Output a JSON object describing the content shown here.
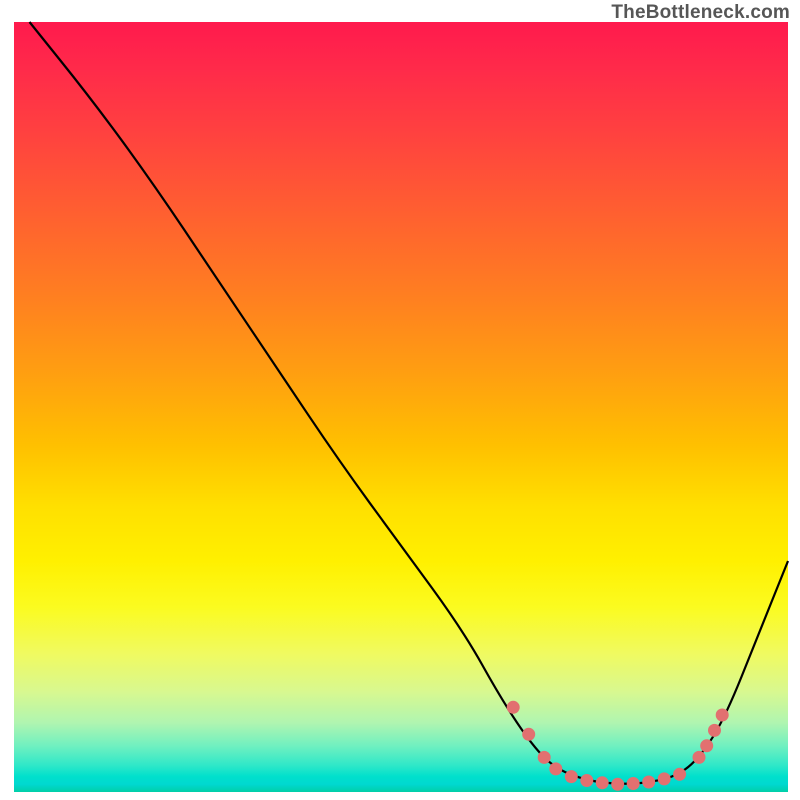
{
  "attribution": "TheBottleneck.com",
  "chart_data": {
    "type": "line",
    "title": "",
    "xlabel": "",
    "ylabel": "",
    "ylim": [
      0,
      100
    ],
    "xlim": [
      0,
      100
    ],
    "curve": [
      {
        "x": 2,
        "y": 100
      },
      {
        "x": 10,
        "y": 90
      },
      {
        "x": 18,
        "y": 79
      },
      {
        "x": 26,
        "y": 67
      },
      {
        "x": 34,
        "y": 55
      },
      {
        "x": 42,
        "y": 43
      },
      {
        "x": 50,
        "y": 32
      },
      {
        "x": 58,
        "y": 21
      },
      {
        "x": 63,
        "y": 12
      },
      {
        "x": 67,
        "y": 6
      },
      {
        "x": 70,
        "y": 3
      },
      {
        "x": 74,
        "y": 1.5
      },
      {
        "x": 78,
        "y": 1
      },
      {
        "x": 82,
        "y": 1.2
      },
      {
        "x": 86,
        "y": 2.2
      },
      {
        "x": 89,
        "y": 5
      },
      {
        "x": 92,
        "y": 10
      },
      {
        "x": 96,
        "y": 20
      },
      {
        "x": 100,
        "y": 30
      }
    ],
    "markers": [
      {
        "x": 64.5,
        "y": 11
      },
      {
        "x": 66.5,
        "y": 7.5
      },
      {
        "x": 68.5,
        "y": 4.5
      },
      {
        "x": 70.0,
        "y": 3.0
      },
      {
        "x": 72.0,
        "y": 2.0
      },
      {
        "x": 74.0,
        "y": 1.5
      },
      {
        "x": 76.0,
        "y": 1.2
      },
      {
        "x": 78.0,
        "y": 1.0
      },
      {
        "x": 80.0,
        "y": 1.1
      },
      {
        "x": 82.0,
        "y": 1.3
      },
      {
        "x": 84.0,
        "y": 1.7
      },
      {
        "x": 86.0,
        "y": 2.3
      },
      {
        "x": 88.5,
        "y": 4.5
      },
      {
        "x": 89.5,
        "y": 6.0
      },
      {
        "x": 90.5,
        "y": 8.0
      },
      {
        "x": 91.5,
        "y": 10.0
      }
    ],
    "gradient_stops": [
      {
        "pos": 0,
        "color": "#ff1a4d"
      },
      {
        "pos": 50,
        "color": "#ffd000"
      },
      {
        "pos": 100,
        "color": "#00cfa8"
      }
    ]
  }
}
